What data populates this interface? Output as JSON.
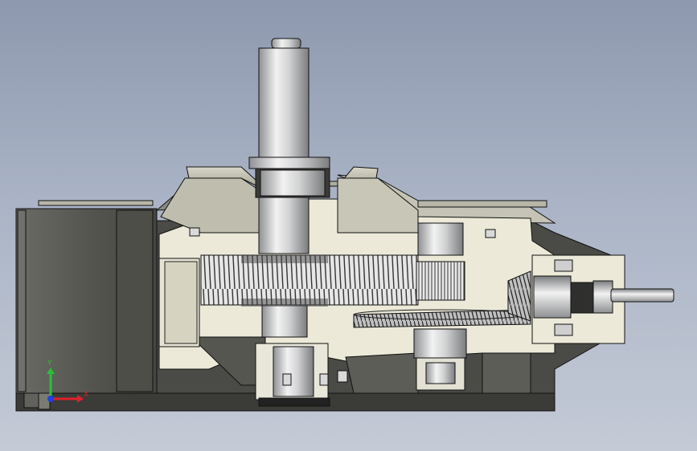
{
  "axes_triad": {
    "x_label": "X",
    "y_label": "Y",
    "x_color": "#e0202a",
    "y_color": "#28c03a",
    "z_color": "#2040e0"
  },
  "colors": {
    "background_top": "#8d98ae",
    "background_bottom": "#c4cad6",
    "housing_dark": "#4a4a46",
    "housing_light": "#ece9d8",
    "steel": "#c9cacb",
    "motor_block": "#5c5d58",
    "edge": "#111111"
  }
}
